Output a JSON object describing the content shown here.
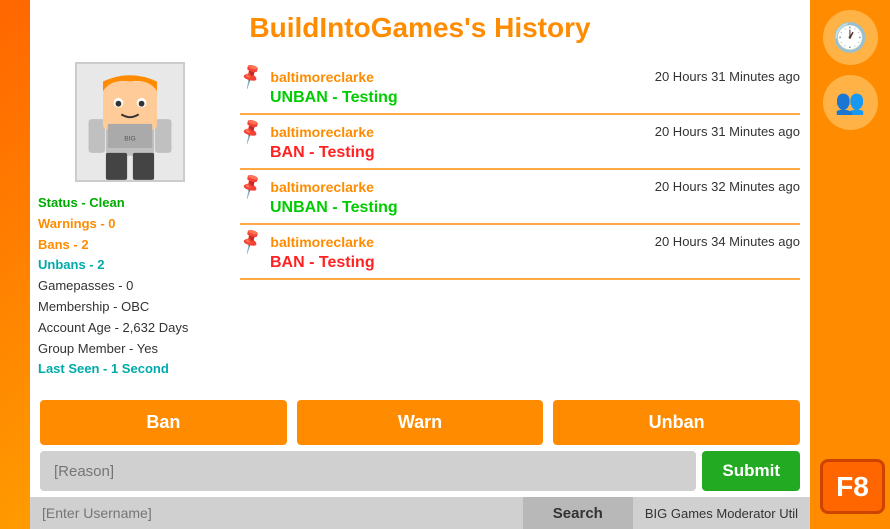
{
  "page": {
    "title": "BuildIntoGames's History",
    "bg_color": "#ff8c00"
  },
  "sidebar": {
    "stats": [
      {
        "label": "Status - Clean",
        "class": "green"
      },
      {
        "label": "Warnings - 0",
        "class": "orange"
      },
      {
        "label": "Bans - 2",
        "class": "orange"
      },
      {
        "label": "Unbans - 2",
        "class": "teal"
      },
      {
        "label": "Gamepasses - 0",
        "class": "normal"
      },
      {
        "label": "Membership - OBC",
        "class": "normal"
      },
      {
        "label": "Account Age - 2,632 Days",
        "class": "normal"
      },
      {
        "label": "Group Member - Yes",
        "class": "normal"
      },
      {
        "label": "Last Seen - 1 Second",
        "class": "teal"
      }
    ]
  },
  "history": {
    "entries": [
      {
        "username": "baltimoreclarke",
        "time": "20 Hours 31 Minutes ago",
        "action": "UNBAN - Testing",
        "action_type": "unban"
      },
      {
        "username": "baltimoreclarke",
        "time": "20 Hours 31 Minutes ago",
        "action": "BAN - Testing",
        "action_type": "ban"
      },
      {
        "username": "baltimoreclarke",
        "time": "20 Hours 32 Minutes ago",
        "action": "UNBAN - Testing",
        "action_type": "unban"
      },
      {
        "username": "baltimoreclarke",
        "time": "20 Hours 34 Minutes ago",
        "action": "BAN - Testing",
        "action_type": "ban"
      }
    ]
  },
  "actions": {
    "ban_label": "Ban",
    "warn_label": "Warn",
    "unban_label": "Unban",
    "submit_label": "Submit",
    "reason_placeholder": "[Reason]",
    "username_placeholder": "[Enter Username]",
    "search_label": "Search",
    "moderator_label": "BIG Games Moderator Util"
  },
  "right_panel": {
    "f8_label": "F8",
    "clock_icon": "🕐",
    "group_icon": "👥"
  }
}
